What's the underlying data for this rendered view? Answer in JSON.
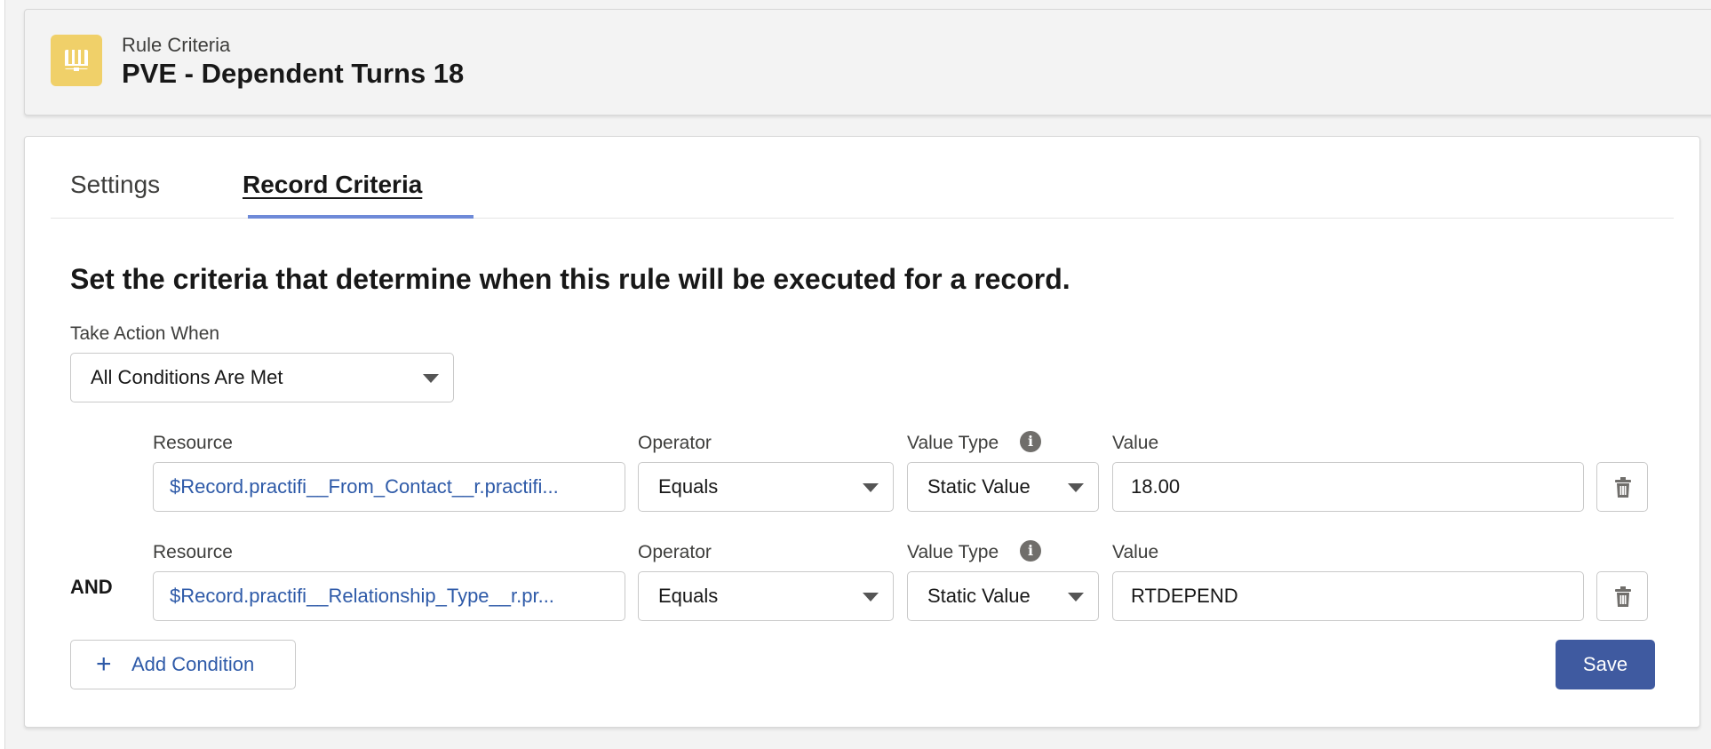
{
  "header": {
    "eyebrow": "Rule Criteria",
    "title": "PVE - Dependent Turns 18",
    "icon": "book-icon",
    "icon_color": "#f0d069"
  },
  "tabs": [
    {
      "label": "Settings",
      "active": false
    },
    {
      "label": "Record Criteria",
      "active": true
    }
  ],
  "section": {
    "heading": "Set the criteria that determine when this rule will be executed for a record."
  },
  "take_action": {
    "label": "Take Action When",
    "value": "All Conditions Are Met"
  },
  "conditions": [
    {
      "prefix": "",
      "resource_label": "Resource",
      "resource_value": "$Record.practifi__From_Contact__r.practifi...",
      "operator_label": "Operator",
      "operator_value": "Equals",
      "value_type_label": "Value Type",
      "value_type_value": "Static Value",
      "value_label": "Value",
      "value": "18.00"
    },
    {
      "prefix": "AND",
      "resource_label": "Resource",
      "resource_value": "$Record.practifi__Relationship_Type__r.pr...",
      "operator_label": "Operator",
      "operator_value": "Equals",
      "value_type_label": "Value Type",
      "value_type_value": "Static Value",
      "value_label": "Value",
      "value": "RTDEPEND"
    }
  ],
  "actions": {
    "add_condition": "Add Condition",
    "save": "Save"
  },
  "colors": {
    "accent": "#3f5aa0",
    "link": "#2e5aa8",
    "tab_indicator": "#6e8ad8"
  }
}
